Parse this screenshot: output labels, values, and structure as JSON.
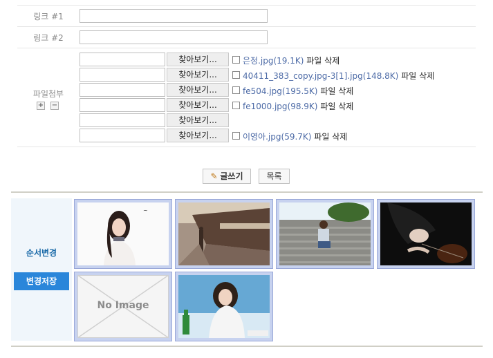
{
  "form": {
    "link1_label": "링크 #1",
    "link2_label": "링크 #2",
    "attach_label": "파일첨부",
    "add_symbol": "+",
    "remove_symbol": "−",
    "browse_label": "찾아보기...",
    "files": [
      {
        "name": "은정.jpg",
        "size": "(19.1K)",
        "delete": "파일 삭제"
      },
      {
        "name": "40411_383_copy.jpg-3[1].jpg",
        "size": "(148.8K)",
        "delete": "파일 삭제"
      },
      {
        "name": "fe504.jpg",
        "size": "(195.5K)",
        "delete": "파일 삭제"
      },
      {
        "name": "fe1000.jpg",
        "size": "(98.9K)",
        "delete": "파일 삭제"
      },
      {
        "name": "",
        "size": "",
        "delete": ""
      },
      {
        "name": "이영아.jpg",
        "size": "(59.7K)",
        "delete": "파일 삭제"
      }
    ]
  },
  "actions": {
    "write_label": "글쓰기",
    "list_label": "목록"
  },
  "gallery": {
    "order_label": "순서변경",
    "save_label": "변경저장",
    "no_image_label": "No Image",
    "thumb_count": 6
  }
}
